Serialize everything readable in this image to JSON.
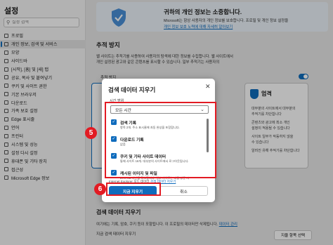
{
  "sidebar": {
    "title": "설정",
    "search_placeholder": "설정 검색",
    "items": [
      {
        "label": "프로필"
      },
      {
        "label": "개인 정보, 검색 및 서비스",
        "active": true
      },
      {
        "label": "모양"
      },
      {
        "label": "사이드바"
      },
      {
        "label": "[시작], [홈] 및 [새] 탭"
      },
      {
        "label": "공유, 복사 및 붙여넣기"
      },
      {
        "label": "쿠키 및 사이트 권한"
      },
      {
        "label": "기본 브라우저"
      },
      {
        "label": "다운로드"
      },
      {
        "label": "가족 보호 설정"
      },
      {
        "label": "Edge 표시줄"
      },
      {
        "label": "언어"
      },
      {
        "label": "프린터"
      },
      {
        "label": "시스템 및 성능"
      },
      {
        "label": "설정 다시 설정"
      },
      {
        "label": "휴대폰 및 기타 장치"
      },
      {
        "label": "접근성"
      },
      {
        "label": "Microsoft Edge 정보"
      }
    ]
  },
  "banner": {
    "title": "귀하의 개인 정보는 소중합니다.",
    "line1": "Microsoft는 항상 사용자의 개인 정보를 보호합니다. 프로필 및 개인 정보 설정을",
    "line2_link": "개인 정보 보호 노력에 대해 자세히 알아보기"
  },
  "tracking": {
    "heading": "추적 방지",
    "line1": "웹 사이트는 추적기를 사용하여 사용자의 탐색에 대한 정보를 수집합니다. 웹 사이트에서",
    "line2": "개인 설정된 광고와 같은 콘텐츠를 표시할 수 있습니다. 일부 추적기는 사용자의",
    "toggle_label": "추적 방지",
    "strict_title": "엄격",
    "strict_bullets": [
      "대부분의 사이트에서 대부분의",
      "추적기를 차단합니다",
      "콘텐츠와 광고에 최소 개인",
      "설정이 적용될 수 있습니다",
      "사이트 일부가 작동하지 않을",
      "수 있습니다",
      "알려진 유해 추적기를 차단합니다"
    ]
  },
  "clear_section": {
    "heading": "검색 데이터 지우기",
    "desc": "여기에는 기록, 암호, 쿠키 등이 포함됩니다. 이 프로필의 데이터만 삭제됩니다.",
    "desc_link": "데이터 관리",
    "now_label": "지금 검색 데이터 지우기",
    "choose_button": "지울 항목 선택"
  },
  "dialog": {
    "title": "검색 데이터 지우기",
    "range_label": "시간 범위",
    "range_value": "모든 시간",
    "items": [
      {
        "title": "검색 기록",
        "desc": "항목 2개. 주소 표시줄에 자동 완성을 포함합니다."
      },
      {
        "title": "다운로드 기록",
        "desc": "없음"
      },
      {
        "title": "쿠키 및 기타 사이트 데이터",
        "desc": "통해 사이트 16개. 대부분의 사이트에서 로그아웃됩니다."
      },
      {
        "title": "캐시된 이미지 및 파일",
        "desc": "20.9 MB 미만을 확보합니다. 일부 사이트는 다음 방문 시"
      }
    ],
    "note_prefix": "Internet Explorer 모드 데이터",
    "note_link": "검색 데이터 지우기",
    "primary_button": "지금 지우기",
    "secondary_button": "취소"
  },
  "steps": {
    "step5": "5",
    "step6": "6"
  }
}
